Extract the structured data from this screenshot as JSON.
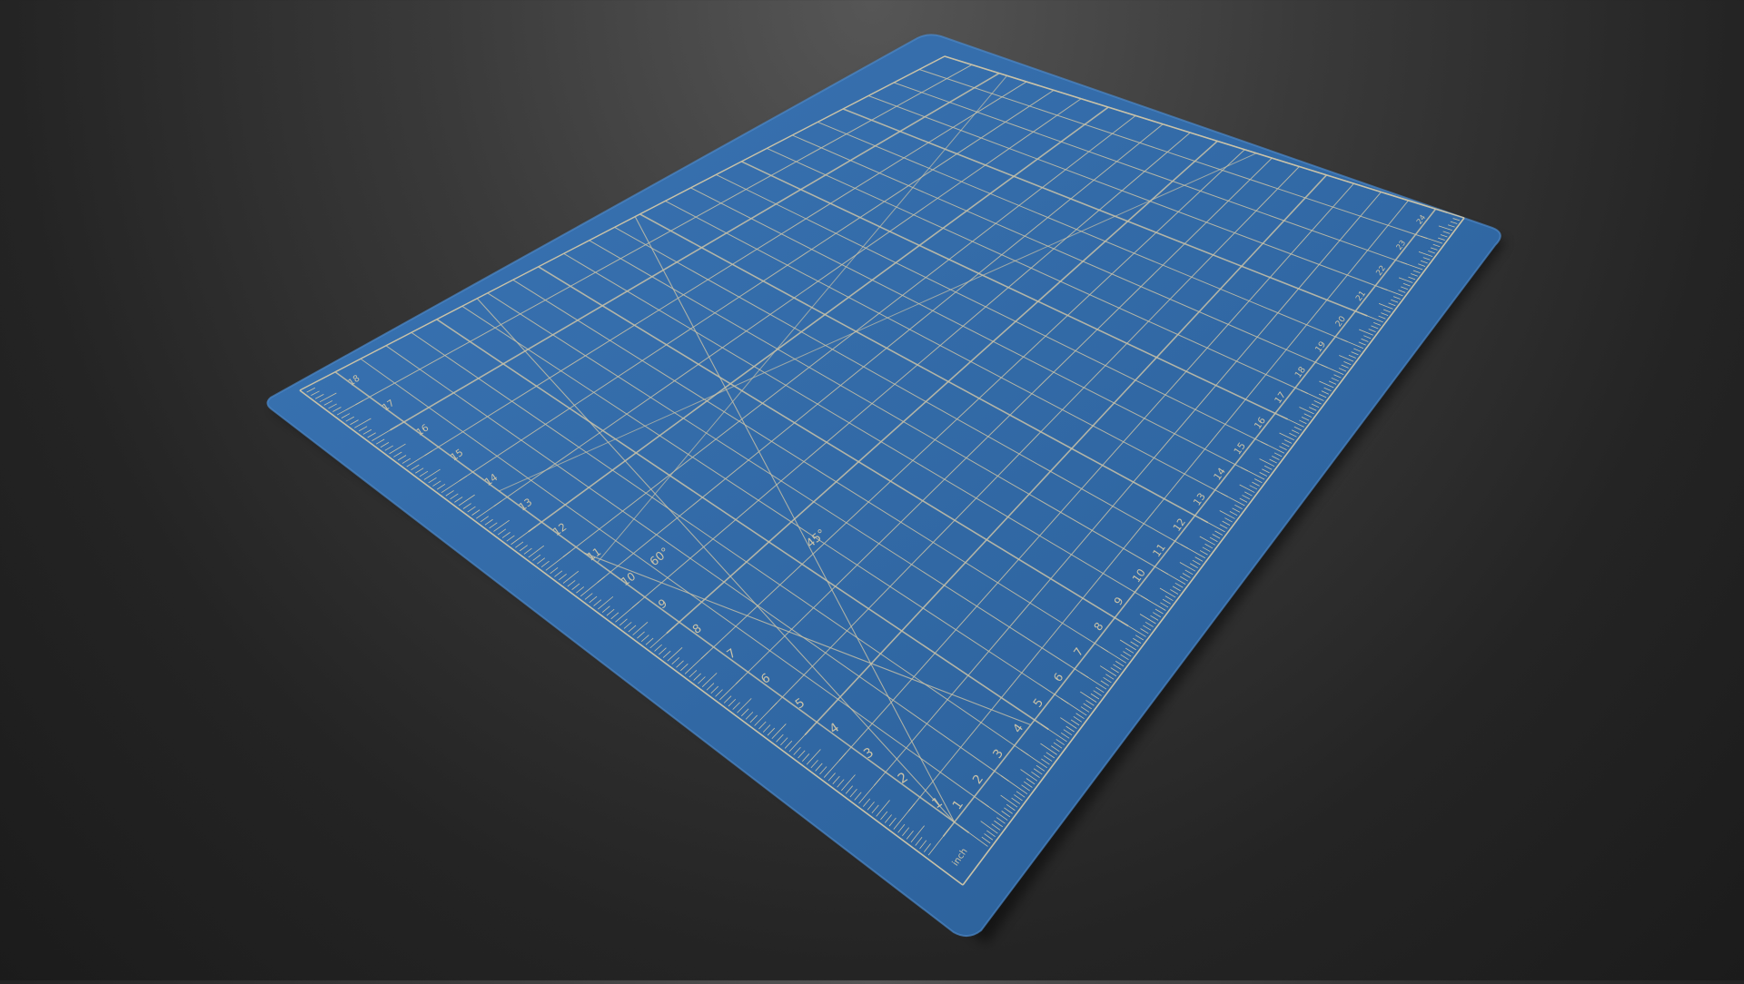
{
  "scene": {
    "subject": "cutting-mat",
    "mat_color": "#2f69a6",
    "mat_edge_color": "#3d7bbd",
    "line_color": "#c9c2a8",
    "background_color": "#2a2a2a"
  },
  "mat": {
    "grid_columns": 24,
    "grid_rows": 18,
    "bottom_ruler_labels": [
      "1",
      "2",
      "3",
      "4",
      "5",
      "6",
      "7",
      "8",
      "9",
      "10",
      "11",
      "12",
      "13",
      "14",
      "15",
      "16",
      "17",
      "18",
      "19",
      "20",
      "21",
      "22",
      "23",
      "24"
    ],
    "left_ruler_labels": [
      "1",
      "2",
      "3",
      "4",
      "5",
      "6",
      "7",
      "8",
      "9",
      "10",
      "11",
      "12",
      "13",
      "14",
      "15",
      "16",
      "17",
      "18"
    ],
    "unit_label": "inch",
    "angle_labels": [
      "60°",
      "45°"
    ]
  }
}
